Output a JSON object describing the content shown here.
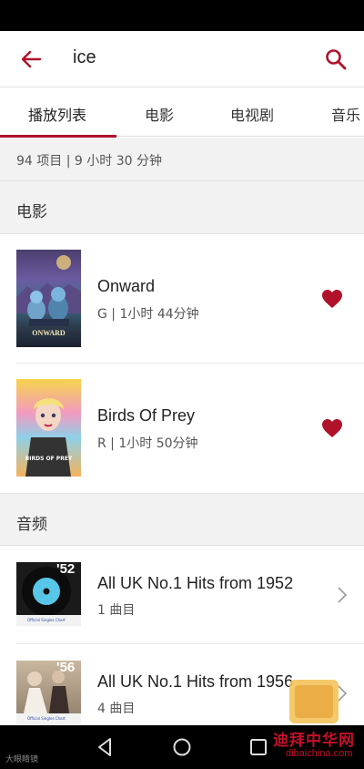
{
  "search": {
    "query": "ice"
  },
  "tabs": [
    {
      "label": "播放列表"
    },
    {
      "label": "电影"
    },
    {
      "label": "电视剧"
    },
    {
      "label": "音乐"
    }
  ],
  "summary": "94 项目 | 9 小时 30 分钟",
  "sections": {
    "movies": {
      "title": "电影",
      "items": [
        {
          "title": "Onward",
          "meta": "G | 1小时 44分钟",
          "poster_text": "ONWARD"
        },
        {
          "title": "Birds Of Prey",
          "meta": "R | 1小时 50分钟",
          "poster_text": "BIRDS OF PREY"
        }
      ]
    },
    "audio": {
      "title": "音频",
      "items": [
        {
          "title": "All UK No.1 Hits from 1952",
          "meta": "1 曲目",
          "cover_year": "'52",
          "cover_caption": "Official Singles Chart"
        },
        {
          "title": "All UK No.1 Hits from 1956",
          "meta": "4 曲目",
          "cover_year": "'56",
          "cover_caption": "Official Singles Chart"
        }
      ]
    }
  },
  "watermarks": {
    "bottom_left": "大眼睛镜",
    "logo_cn": "迪拜中华网",
    "logo_en": "dibaichina.com"
  },
  "colors": {
    "accent": "#b0122a",
    "heart": "#b0122a",
    "section_bg": "#f2f2f2",
    "status_bar": "#000000"
  },
  "icons": {
    "back": "arrow-left-icon",
    "search": "search-icon",
    "favorite": "heart-icon",
    "chevron": "chevron-right-icon"
  }
}
